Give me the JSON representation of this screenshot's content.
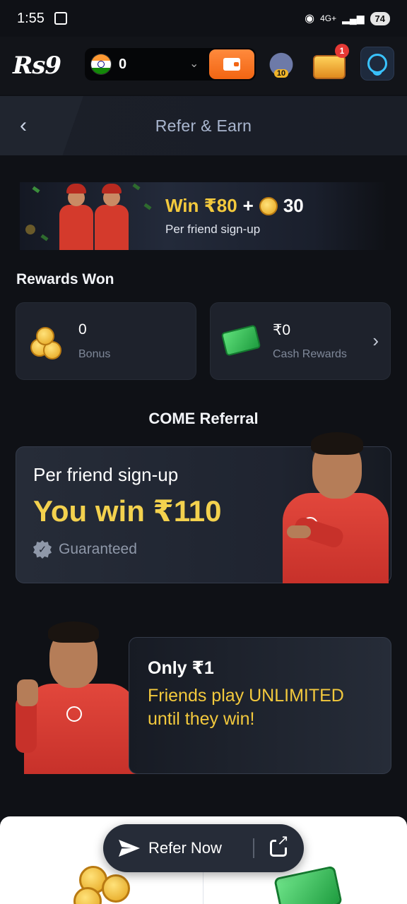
{
  "status_bar": {
    "time": "1:55",
    "network": "4G+",
    "battery": "74"
  },
  "header": {
    "logo": "Rs9",
    "balance": "0",
    "pot_badge": "10",
    "notification_count": "1"
  },
  "title_bar": {
    "title": "Refer & Earn"
  },
  "promo": {
    "win_amount": "Win ₹80",
    "plus": "+",
    "coin_amount": "30",
    "subtitle": "Per friend sign-up"
  },
  "rewards": {
    "heading": "Rewards Won",
    "bonus_value": "0",
    "bonus_label": "Bonus",
    "cash_value": "₹0",
    "cash_label": "Cash Rewards"
  },
  "come_referral": {
    "heading": "COME Referral",
    "line1": "Per friend sign-up",
    "line2": "You win ₹110",
    "guaranteed": "Guaranteed"
  },
  "unlimited": {
    "only": "Only ₹1",
    "friends": "Friends play UNLIMITED until they win!"
  },
  "cta": {
    "refer_now": "Refer Now"
  },
  "colors": {
    "accent_gold": "#f3c93d",
    "wallet_orange": "#f26513",
    "background": "#0f1116"
  },
  "icons": [
    "qr-scan-icon",
    "hotspot-icon",
    "signal-icon",
    "chevron-down-icon",
    "wallet-icon",
    "pot-icon",
    "treasure-chest-icon",
    "support-icon",
    "back-arrow-icon",
    "coin-icon",
    "cash-icon",
    "chevron-right-icon",
    "verified-badge-icon",
    "send-icon",
    "share-icon"
  ]
}
